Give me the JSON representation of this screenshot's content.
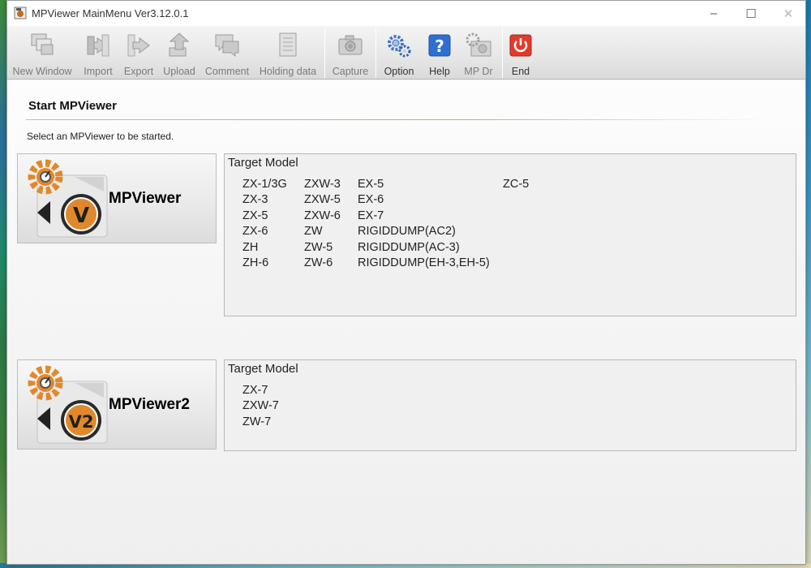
{
  "window": {
    "title": "MPViewer MainMenu Ver3.12.0.1",
    "controls": {
      "minimize": "–",
      "maximize": "☐",
      "close": "✕"
    }
  },
  "toolbar": {
    "items": [
      {
        "label": "New Window",
        "icon": "new-window-icon",
        "enabled": false
      },
      {
        "label": "Import",
        "icon": "import-icon",
        "enabled": false
      },
      {
        "label": "Export",
        "icon": "export-icon",
        "enabled": false
      },
      {
        "label": "Upload",
        "icon": "upload-icon",
        "enabled": false
      },
      {
        "label": "Comment",
        "icon": "comment-icon",
        "enabled": false
      },
      {
        "label": "Holding data",
        "icon": "holding-data-icon",
        "enabled": false
      },
      {
        "label": "Capture",
        "icon": "camera-icon",
        "enabled": false
      },
      {
        "label": "Option",
        "icon": "gears-icon",
        "enabled": true
      },
      {
        "label": "Help",
        "icon": "help-icon",
        "enabled": true
      },
      {
        "label": "MP Dr",
        "icon": "mp-dr-icon",
        "enabled": false
      },
      {
        "label": "End",
        "icon": "power-icon",
        "enabled": true
      }
    ]
  },
  "main": {
    "title": "Start MPViewer",
    "instruction": "Select an MPViewer to be started.",
    "viewers": [
      {
        "label": "MPViewer",
        "badge": "V",
        "target_title": "Target Model",
        "models": [
          "ZX-1/3G",
          "ZX-3",
          "ZX-5",
          "ZX-6",
          "ZH",
          "ZH-6",
          "ZXW-3",
          "ZXW-5",
          "ZXW-6",
          "ZW",
          "ZW-5",
          "ZW-6",
          "EX-5",
          "EX-6",
          "EX-7",
          "RIGIDDUMP(AC2)",
          "RIGIDDUMP(AC-3)",
          "RIGIDDUMP(EH-3,EH-5)",
          "ZC-5"
        ]
      },
      {
        "label": "MPViewer2",
        "badge": "V2",
        "target_title": "Target Model",
        "models": [
          "ZX-7",
          "ZXW-7",
          "ZW-7"
        ]
      }
    ]
  },
  "colors": {
    "accent_orange": "#e0892c",
    "help_blue": "#2f6fd0",
    "end_red": "#e23a2a"
  }
}
